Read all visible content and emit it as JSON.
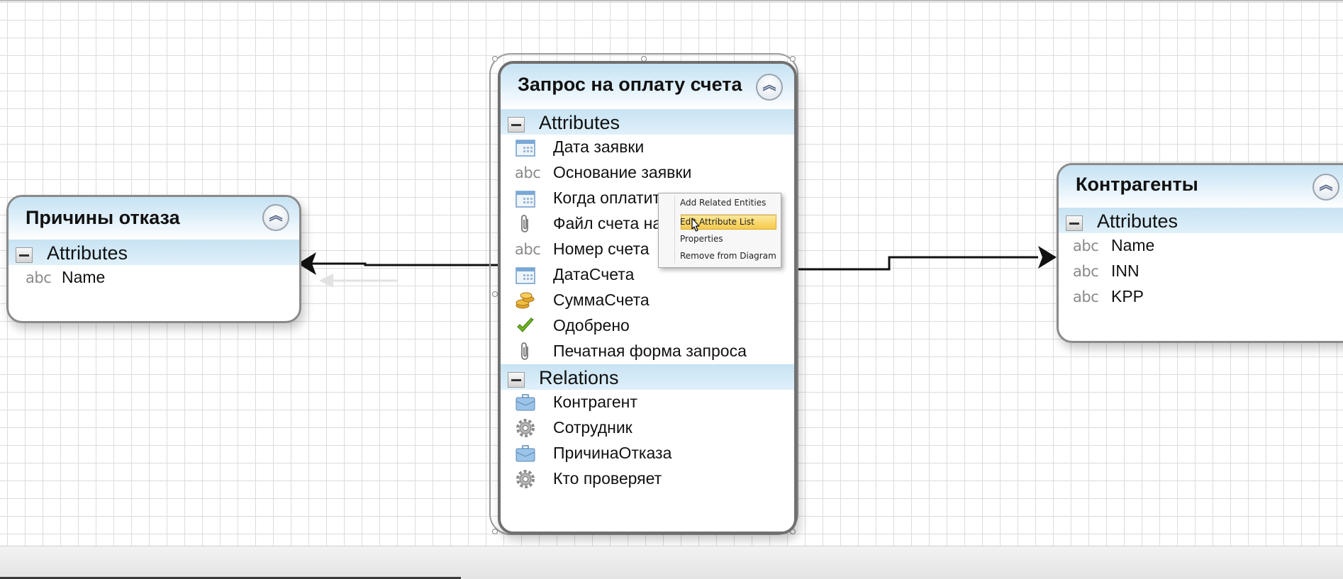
{
  "entities": {
    "left": {
      "title": "Причины отказа",
      "collapse_glyph": "︽",
      "sections": {
        "attributes": {
          "title": "Attributes",
          "items": [
            {
              "label": "Name",
              "icon": "abc",
              "icon_name": "text-field-icon"
            }
          ]
        }
      }
    },
    "center": {
      "title": "Запрос на оплату счета",
      "collapse_glyph": "︽",
      "sections": {
        "attributes": {
          "title": "Attributes",
          "items": [
            {
              "label": "Дата заявки",
              "icon_name": "calendar-icon"
            },
            {
              "label": "Основание заявки",
              "icon": "abc",
              "icon_name": "text-field-icon"
            },
            {
              "label": "Когда оплатить",
              "icon_name": "calendar-icon"
            },
            {
              "label": "Файл счета на",
              "icon_name": "paperclip-icon"
            },
            {
              "label": "Номер счета",
              "icon": "abc",
              "icon_name": "text-field-icon"
            },
            {
              "label": "ДатаСчета",
              "icon_name": "calendar-icon"
            },
            {
              "label": "СуммаСчета",
              "icon_name": "coins-icon"
            },
            {
              "label": "Одобрено",
              "icon_name": "checkmark-icon"
            },
            {
              "label": "Печатная форма запроса",
              "icon_name": "paperclip-icon"
            }
          ]
        },
        "relations": {
          "title": "Relations",
          "items": [
            {
              "label": "Контрагент",
              "icon_name": "briefcase-icon"
            },
            {
              "label": "Сотрудник",
              "icon_name": "gear-icon"
            },
            {
              "label": "ПричинаОтказа",
              "icon_name": "briefcase-icon"
            },
            {
              "label": "Кто проверяет",
              "icon_name": "gear-icon"
            }
          ]
        }
      }
    },
    "right": {
      "title": "Контрагенты",
      "collapse_glyph": "︽",
      "sections": {
        "attributes": {
          "title": "Attributes",
          "items": [
            {
              "label": "Name",
              "icon": "abc",
              "icon_name": "text-field-icon"
            },
            {
              "label": "INN",
              "icon": "abc",
              "icon_name": "text-field-icon"
            },
            {
              "label": "KPP",
              "icon": "abc",
              "icon_name": "text-field-icon"
            }
          ]
        }
      }
    }
  },
  "context_menu": {
    "items": [
      {
        "label": "Add Related Entities"
      },
      {
        "label": "Edit Attribute List",
        "highlighted": true
      },
      {
        "label": "Properties"
      },
      {
        "label": "Remove from Diagram"
      }
    ]
  },
  "colors": {
    "header_gradient": "#c6e2f4",
    "section_band": "#c8e3f3",
    "border": "#8a8a8a",
    "menu_highlight": "#f6c94a"
  }
}
